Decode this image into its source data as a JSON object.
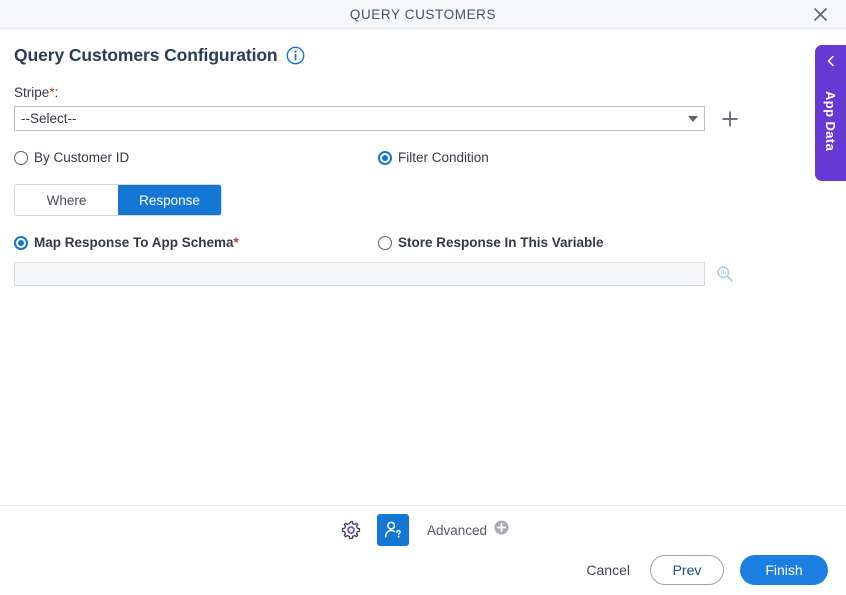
{
  "window": {
    "title": "QUERY CUSTOMERS",
    "close_icon": "close-icon"
  },
  "side_panel": {
    "label": "App Data",
    "collapse_icon": "chevron-left-icon"
  },
  "page": {
    "heading": "Query Customers Configuration",
    "info_icon": "info-circle-icon"
  },
  "stripe_field": {
    "label": "Stripe",
    "required_marker": "*",
    "label_suffix": ":",
    "selected_value": "--Select--",
    "caret_icon": "chevron-down-icon",
    "add_icon": "plus-icon"
  },
  "mode_radios": [
    {
      "label": "By Customer ID",
      "selected": false
    },
    {
      "label": "Filter Condition",
      "selected": true
    }
  ],
  "tabs": [
    {
      "label": "Where",
      "active": false
    },
    {
      "label": "Response",
      "active": true
    }
  ],
  "response_radios": [
    {
      "label": "Map Response To App Schema",
      "required_marker": "*",
      "selected": true
    },
    {
      "label": "Store Response In This Variable",
      "required_marker": "",
      "selected": false
    }
  ],
  "schema_field": {
    "value": "",
    "placeholder": "",
    "search_icon": "search-icon"
  },
  "toolbar": {
    "settings_icon": "gear-icon",
    "user_icon": "user-question-icon",
    "advanced_label": "Advanced",
    "advanced_add_icon": "plus-circle-icon"
  },
  "actions": {
    "cancel": "Cancel",
    "prev": "Prev",
    "finish": "Finish"
  },
  "colors": {
    "accent_blue": "#1477d4",
    "app_data_purple": "#6838d4",
    "required_red": "#c0392b",
    "title_navy": "#2a3b5c",
    "finish_blue": "#1a7fe0"
  }
}
